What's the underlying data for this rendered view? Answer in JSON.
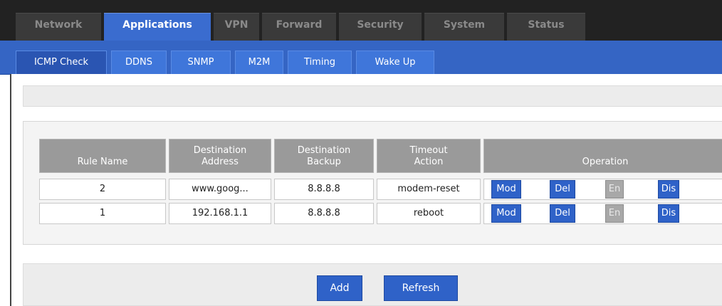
{
  "nav": {
    "tabs": [
      {
        "label": "Network"
      },
      {
        "label": "Applications"
      },
      {
        "label": "VPN"
      },
      {
        "label": "Forward"
      },
      {
        "label": "Security"
      },
      {
        "label": "System"
      },
      {
        "label": "Status"
      }
    ],
    "active": "Applications"
  },
  "subnav": {
    "tabs": [
      {
        "label": "ICMP Check"
      },
      {
        "label": "DDNS"
      },
      {
        "label": "SNMP"
      },
      {
        "label": "M2M"
      },
      {
        "label": "Timing"
      },
      {
        "label": "Wake Up"
      }
    ],
    "active": "ICMP Check"
  },
  "table": {
    "headers": {
      "rule_name": "Rule Name",
      "dest_address_l1": "Destination",
      "dest_address_l2": "Address",
      "dest_backup_l1": "Destination",
      "dest_backup_l2": "Backup",
      "timeout_l1": "Timeout",
      "timeout_l2": "Action",
      "operation": "Operation"
    },
    "rows": [
      {
        "rule_name": "2",
        "dest_address": "www.goog...",
        "dest_backup": "8.8.8.8",
        "timeout_action": "modem-reset",
        "ops": {
          "mod": "Mod",
          "del": "Del",
          "en": "En",
          "dis": "Dis"
        }
      },
      {
        "rule_name": "1",
        "dest_address": "192.168.1.1",
        "dest_backup": "8.8.8.8",
        "timeout_action": "reboot",
        "ops": {
          "mod": "Mod",
          "del": "Del",
          "en": "En",
          "dis": "Dis"
        }
      }
    ]
  },
  "buttons": {
    "add": "Add",
    "refresh": "Refresh"
  },
  "colors": {
    "accent": "#3565c4",
    "button": "#2f62c8",
    "header_gray": "#9a9a9a",
    "dark_nav": "#222222"
  }
}
